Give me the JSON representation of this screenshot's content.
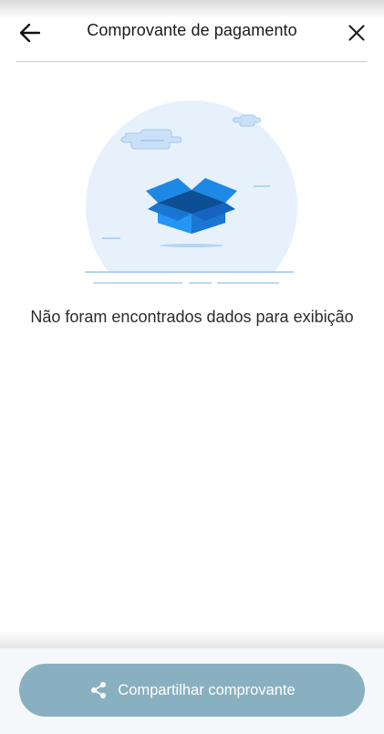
{
  "header": {
    "title": "Comprovante de pagamento",
    "back_icon": "arrow-left-icon",
    "close_icon": "close-icon"
  },
  "empty_state": {
    "illustration": "empty-box-illustration",
    "message": "Não foram encontrados dados para exibição"
  },
  "footer": {
    "share_label": "Compartilhar comprovante",
    "share_icon": "share-icon"
  },
  "colors": {
    "primary_blue": "#1E88E5",
    "illustration_circle": "#E6F1FC",
    "button_disabled": "#89B0C0",
    "title_text": "#1A1A1A"
  }
}
